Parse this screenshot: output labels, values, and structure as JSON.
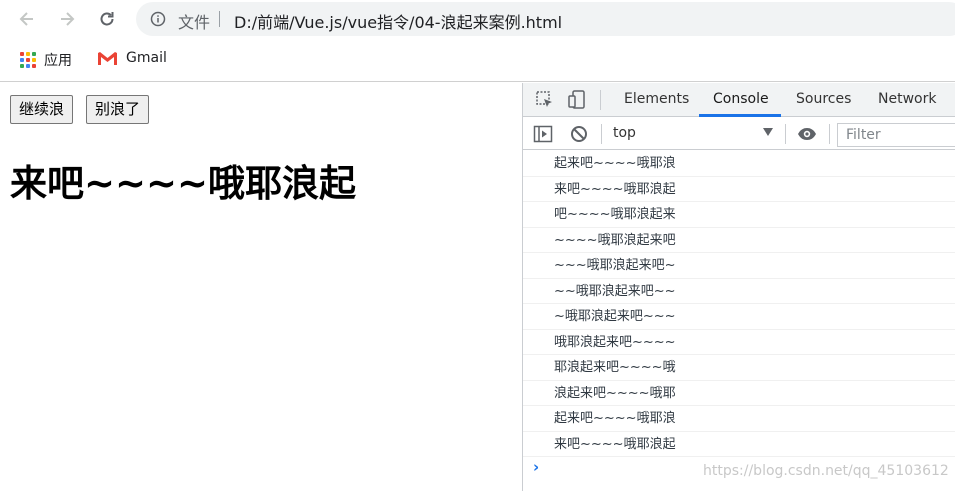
{
  "browser": {
    "omnibox_label": "文件",
    "url": "D:/前端/Vue.js/vue指令/04-浪起来案例.html"
  },
  "bookmarks": {
    "apps_label": "应用",
    "gmail_label": "Gmail"
  },
  "page": {
    "continue_button": "继续浪",
    "stop_button": "别浪了",
    "marquee_text": "来吧~~~~哦耶浪起"
  },
  "devtools": {
    "tabs": [
      "Elements",
      "Console",
      "Sources",
      "Network"
    ],
    "active_tab": "Console",
    "context": "top",
    "filter_placeholder": "Filter",
    "logs": [
      "起来吧~~~~哦耶浪",
      "来吧~~~~哦耶浪起",
      "吧~~~~哦耶浪起来",
      "~~~~哦耶浪起来吧",
      "~~~哦耶浪起来吧~",
      "~~哦耶浪起来吧~~",
      "~哦耶浪起来吧~~~",
      "哦耶浪起来吧~~~~",
      "耶浪起来吧~~~~哦",
      "浪起来吧~~~~哦耶",
      "起来吧~~~~哦耶浪",
      "来吧~~~~哦耶浪起"
    ],
    "prompt_symbol": "›",
    "watermark": "https://blog.csdn.net/qq_45103612"
  },
  "colors": {
    "accent": "#1a73e8",
    "gmail_red": "#ea4335"
  }
}
